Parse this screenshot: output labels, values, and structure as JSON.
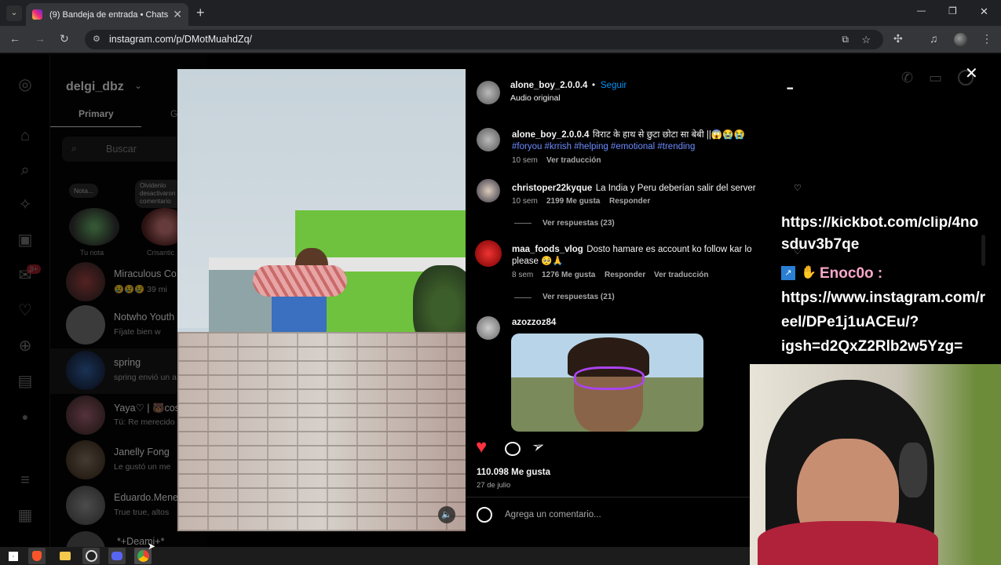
{
  "browser": {
    "tab_title": "(9) Bandeja de entrada • Chats",
    "url": "instagram.com/p/DMotMuahdZq/",
    "new_tab": "+",
    "tab_close": "✕",
    "window_minimize": "—",
    "window_restore": "❐",
    "window_close": "✕"
  },
  "inbox": {
    "username": "delgi_dbz",
    "tab_primary": "Primary",
    "tab_general_partial": "G",
    "search_placeholder": "Buscar",
    "note_bubble_1": "Nota...",
    "note_bubble_2": "Olvidenlo desactivaron comentario",
    "story_1_label": "Tu nota",
    "story_2_label": "Crisantic",
    "conversations": [
      {
        "name": "Miraculous Co",
        "preview": "😢😢😢 39 mi"
      },
      {
        "name": "Notwho Youth",
        "preview": "Fíjate bien w"
      },
      {
        "name": "spring",
        "preview": "spring envió un a"
      },
      {
        "name": "Yaya♡ | 🐻cosp",
        "preview": "Tú: Re merecido"
      },
      {
        "name": "Janelly Fong",
        "preview": "Le gustó un me"
      },
      {
        "name": "Eduardo.Mene",
        "preview": "True true, altos"
      },
      {
        "name": "*+Deami+*",
        "preview": ""
      }
    ],
    "badge": "9+"
  },
  "post": {
    "author": "alone_boy_2.0.0.4",
    "follow": "Seguir",
    "audio": "Audio original",
    "more": "•••",
    "dot": "•",
    "caption_text": "विराट के हाथ से छुटा छोटा सा बेबी ||😱😭😭",
    "caption_tags": "#foryou #krrish #helping #emotional #trending",
    "caption_time": "10 sem",
    "caption_translate": "Ver traducción",
    "comments": [
      {
        "user": "christoper22kyque",
        "text": "La India y Peru deberían salir del server",
        "time": "10 sem",
        "likes": "2199 Me gusta",
        "reply": "Responder",
        "view_replies": "Ver respuestas (23)"
      },
      {
        "user": "maa_foods_vlog",
        "text": "Dosto hamare es account ko follow kar lo please 🥺🙏",
        "time": "8 sem",
        "likes": "1276 Me gusta",
        "reply": "Responder",
        "translate": "Ver traducción",
        "view_replies": "Ver respuestas (21)"
      },
      {
        "user": "azozzoz84"
      }
    ],
    "like_count": "110.098 Me gusta",
    "date": "27 de julio",
    "comment_placeholder": "Agrega un comentario...",
    "close": "✕"
  },
  "chat_overlay": {
    "line1": "https://kickbot.com/clip/4no",
    "line2": "sduv3b7qe",
    "user": "Enoc0o :",
    "line3": "https://www.instagram.com/r",
    "line4": "eel/DPe1j1uACEu/?",
    "line5": "igsh=d2QxZ2Rlb2w5Yzg="
  },
  "colors": {
    "link_blue": "#0095f6",
    "hashtag_blue": "#6c8cff",
    "heart_red": "#ff3040",
    "chrome_dark": "#202124"
  }
}
